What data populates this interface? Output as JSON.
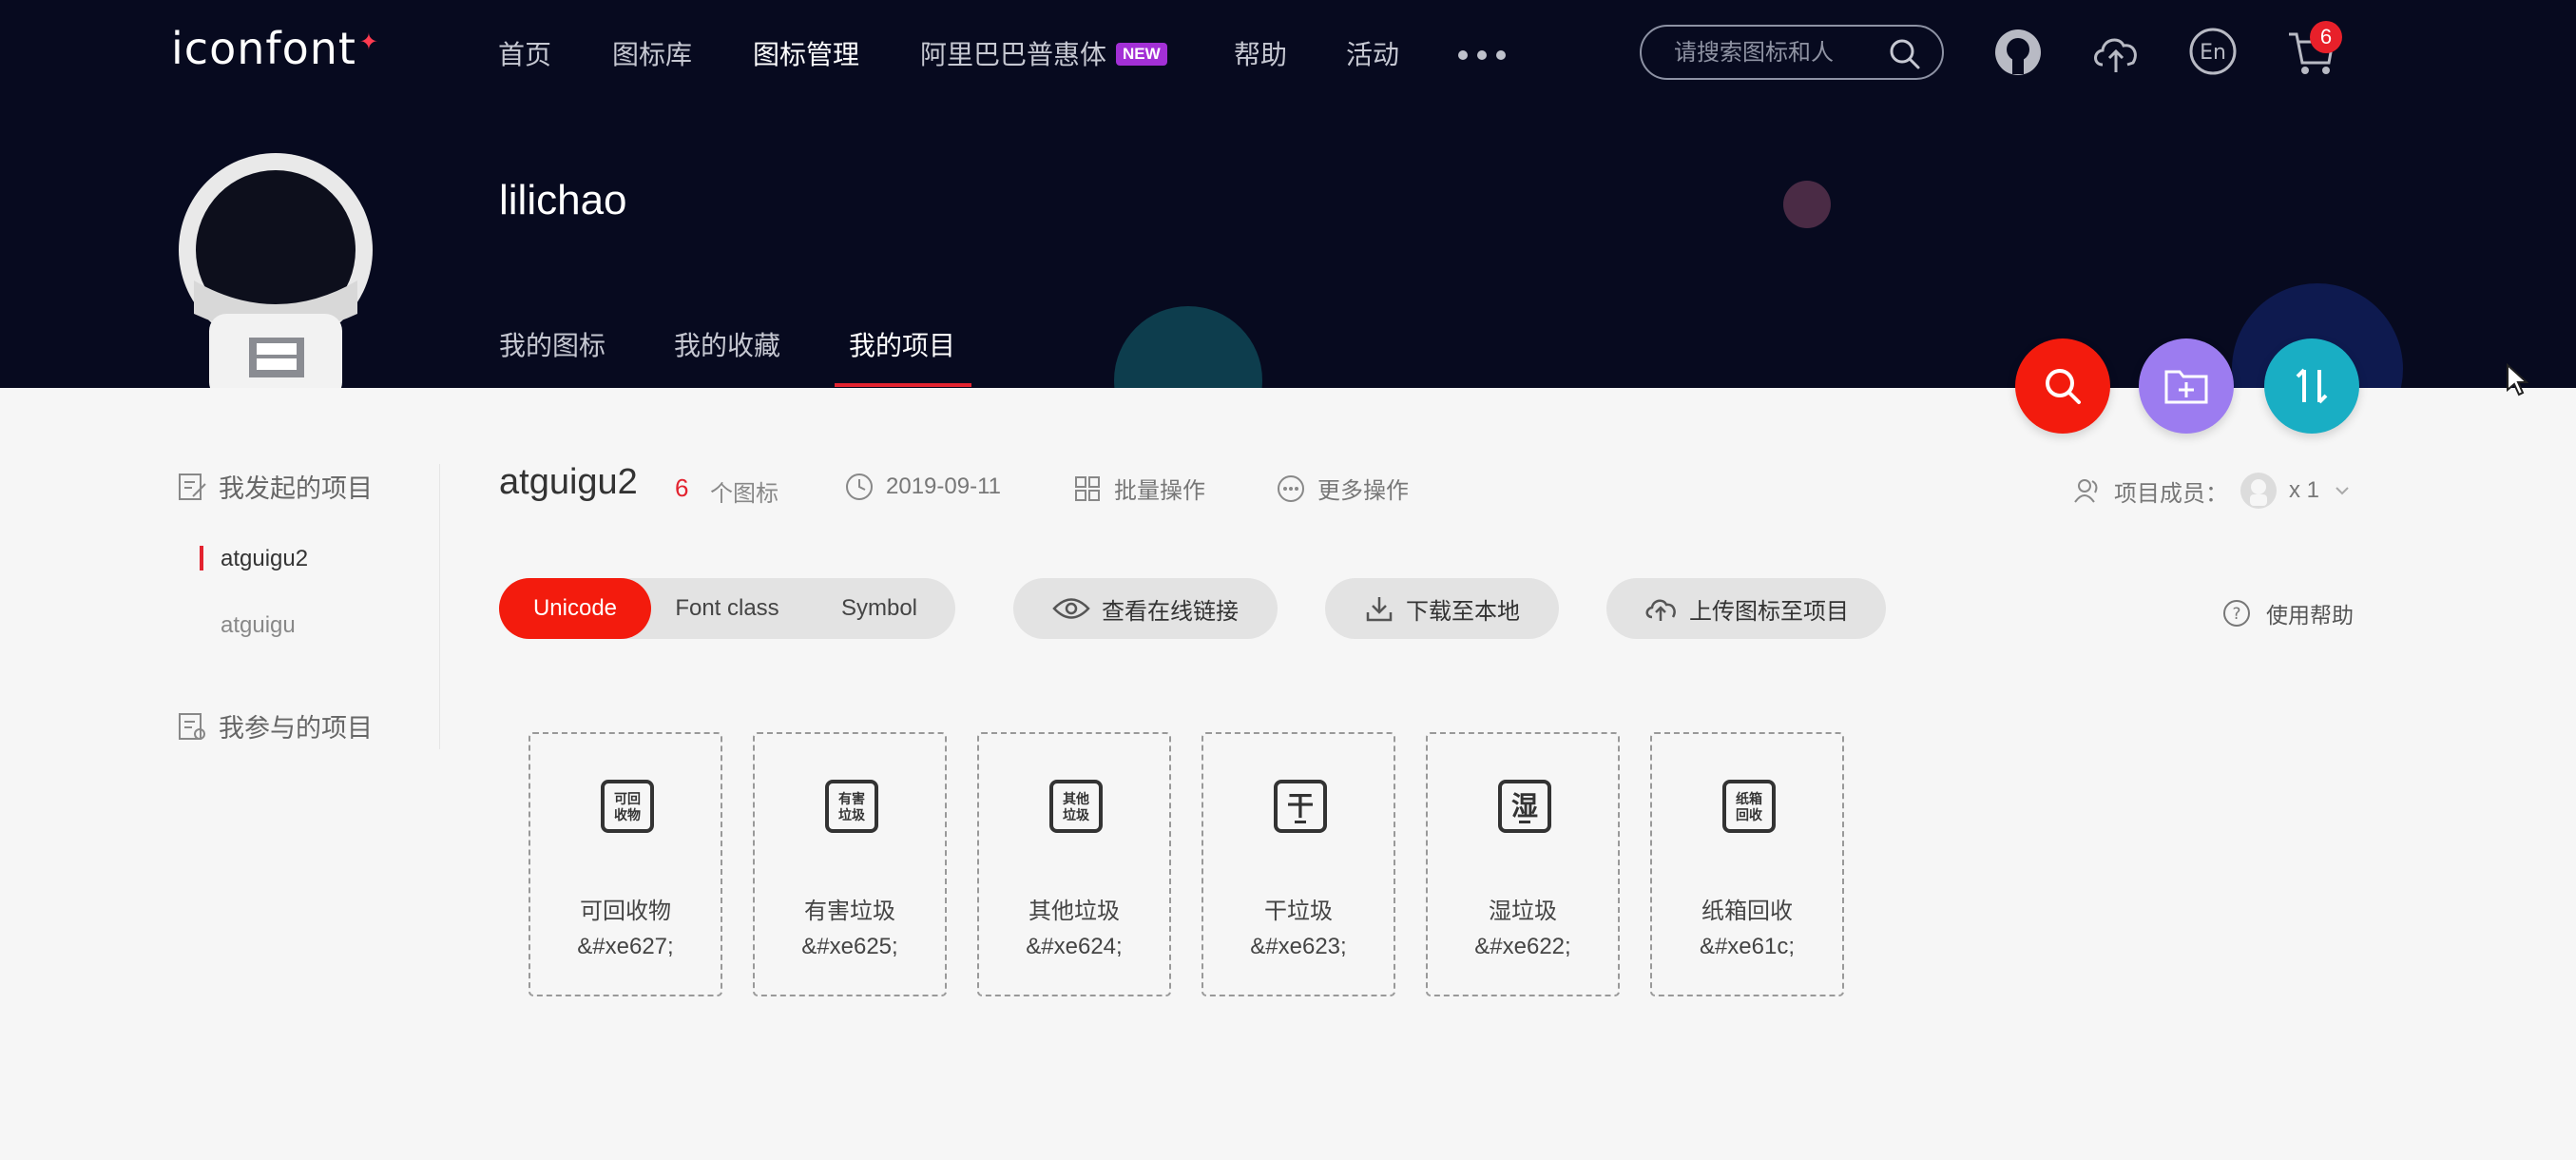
{
  "nav": {
    "logo": "iconfont",
    "logo_mark": "✦",
    "items": [
      "首页",
      "图标库",
      "图标管理",
      "阿里巴巴普惠体",
      "帮助",
      "活动"
    ],
    "new_badge": "NEW",
    "search_placeholder": "请搜索图标和人",
    "cart_count": "6",
    "icons": [
      "github-icon",
      "cloud-upload-icon",
      "language-en-icon",
      "cart-icon"
    ]
  },
  "profile": {
    "username": "lilichao",
    "tabs": [
      "我的图标",
      "我的收藏",
      "我的项目"
    ]
  },
  "fabs": [
    "search-icon",
    "add-folder-icon",
    "sort-icon"
  ],
  "sidebar": {
    "started_heading": "我发起的项目",
    "projects": [
      "atguigu2",
      "atguigu"
    ],
    "joined_heading": "我参与的项目"
  },
  "project": {
    "title": "atguigu2",
    "icon_count": "6",
    "icon_count_label": "个图标",
    "date": "2019-09-11",
    "batch_label": "批量操作",
    "more_label": "更多操作",
    "members_label": "项目成员：",
    "members_count": "x 1",
    "formats": [
      "Unicode",
      "Font class",
      "Symbol"
    ],
    "actions": [
      "查看在线链接",
      "下载至本地",
      "上传图标至项目"
    ],
    "help_label": "使用帮助"
  },
  "icons": [
    {
      "name": "可回收物",
      "code": "&#xe627;",
      "glyph": "可回收物"
    },
    {
      "name": "有害垃圾",
      "code": "&#xe625;",
      "glyph": "有害垃圾"
    },
    {
      "name": "其他垃圾",
      "code": "&#xe624;",
      "glyph": "其他垃圾"
    },
    {
      "name": "干垃圾",
      "code": "&#xe623;",
      "glyph": "干"
    },
    {
      "name": "湿垃圾",
      "code": "&#xe622;",
      "glyph": "湿"
    },
    {
      "name": "纸箱回收",
      "code": "&#xe61c;",
      "glyph": "纸箱回收"
    }
  ],
  "colors": {
    "header_bg": "#070a1f",
    "accent_red": "#f31b0d",
    "fab_search": "#f31b0d",
    "fab_folder": "#9c7cf0",
    "fab_sort": "#19aec4",
    "new_badge": "#a330d6"
  }
}
